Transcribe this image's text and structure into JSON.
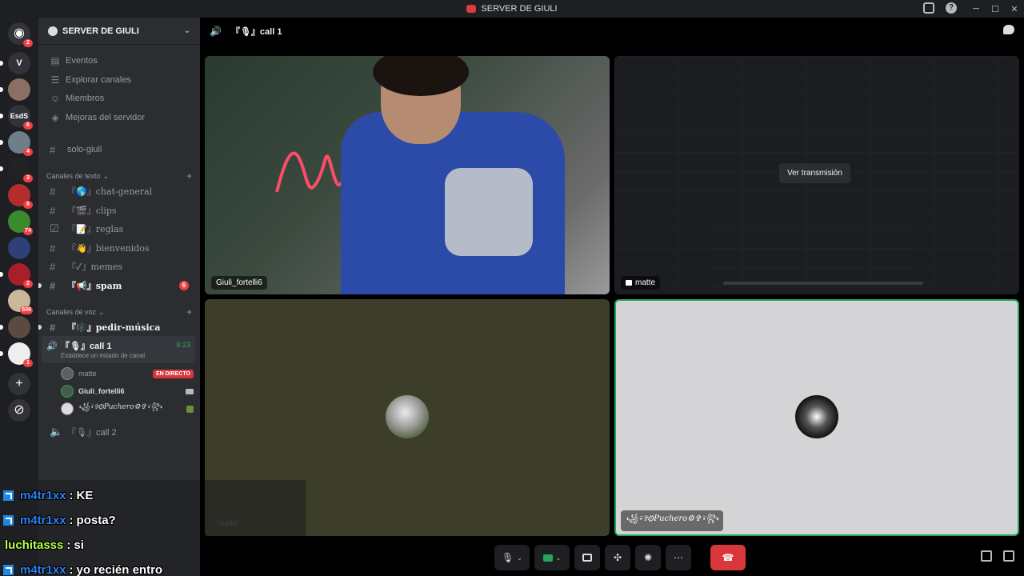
{
  "window": {
    "title": "SERVER DE GIULI"
  },
  "rail": {
    "home_badge": "2",
    "servers": [
      {
        "label": "V",
        "badge": ""
      },
      {
        "label": "",
        "badge": ""
      },
      {
        "label": "EsdS",
        "badge": "6"
      },
      {
        "label": "",
        "badge": "4"
      },
      {
        "label": "",
        "badge": "3"
      },
      {
        "label": "",
        "badge": "8"
      },
      {
        "label": "",
        "badge": "74"
      },
      {
        "label": "",
        "badge": ""
      },
      {
        "label": "",
        "badge": "2"
      },
      {
        "label": "",
        "badge": "606"
      },
      {
        "label": "",
        "badge": ""
      },
      {
        "label": "",
        "badge": "1"
      }
    ]
  },
  "sidebar": {
    "guild_name": "SERVER DE GIULI",
    "items": [
      {
        "label": "Eventos"
      },
      {
        "label": "Explorar canales"
      },
      {
        "label": "Miembros"
      },
      {
        "label": "Mejoras del servidor"
      }
    ],
    "solo_channel": "solo-giuli",
    "text_category": "Canales de texto",
    "text_channels": [
      {
        "name": "『🌎』chat-general",
        "bold": false,
        "count": ""
      },
      {
        "name": "『🎬』clips",
        "bold": false,
        "count": ""
      },
      {
        "name": "『📝』reglas",
        "bold": false,
        "count": ""
      },
      {
        "name": "『👋』bienvenidos",
        "bold": false,
        "count": ""
      },
      {
        "name": "『✓』memes",
        "bold": false,
        "count": ""
      },
      {
        "name": "『📢』spam",
        "bold": true,
        "count": "6"
      }
    ],
    "voice_category": "Canales de voz",
    "music_channel": "『🎼』pedir-música",
    "active_voice": {
      "name": "『🎙』call 1",
      "status": "Establece un estado de canal",
      "time": "8:23"
    },
    "voice_users": [
      {
        "name": "matte",
        "tag": "EN DIRECTO"
      },
      {
        "name": "Giuli_fortelli6",
        "tag": ""
      },
      {
        "name": "꧁⍣✞⚙Puchero⚙✞⍣꧂",
        "tag": ""
      }
    ],
    "other_voice": "『🎙』call 2"
  },
  "main": {
    "channel_title": "『🎙』call 1",
    "tiles": [
      {
        "name": "Giuli_fortelli6"
      },
      {
        "name": "matte",
        "watch_label": "Ver transmisión"
      },
      {
        "name": "matte"
      },
      {
        "name": "꧁⍣✞⚙Puchero⚙✞⍣꧂"
      }
    ]
  },
  "chat_overlay": [
    {
      "user": "m4tr1xx",
      "message": "KE",
      "green": false
    },
    {
      "user": "m4tr1xx",
      "message": "posta?",
      "green": false
    },
    {
      "user": "luchitasss",
      "message": "si",
      "green": true
    },
    {
      "user": "m4tr1xx",
      "message": "yo recién entro",
      "green": false
    }
  ],
  "colors": {
    "accent_green": "#23a55a",
    "danger_red": "#da373c",
    "sidebar_bg": "#2b2d31",
    "rail_bg": "#1e1f22"
  }
}
